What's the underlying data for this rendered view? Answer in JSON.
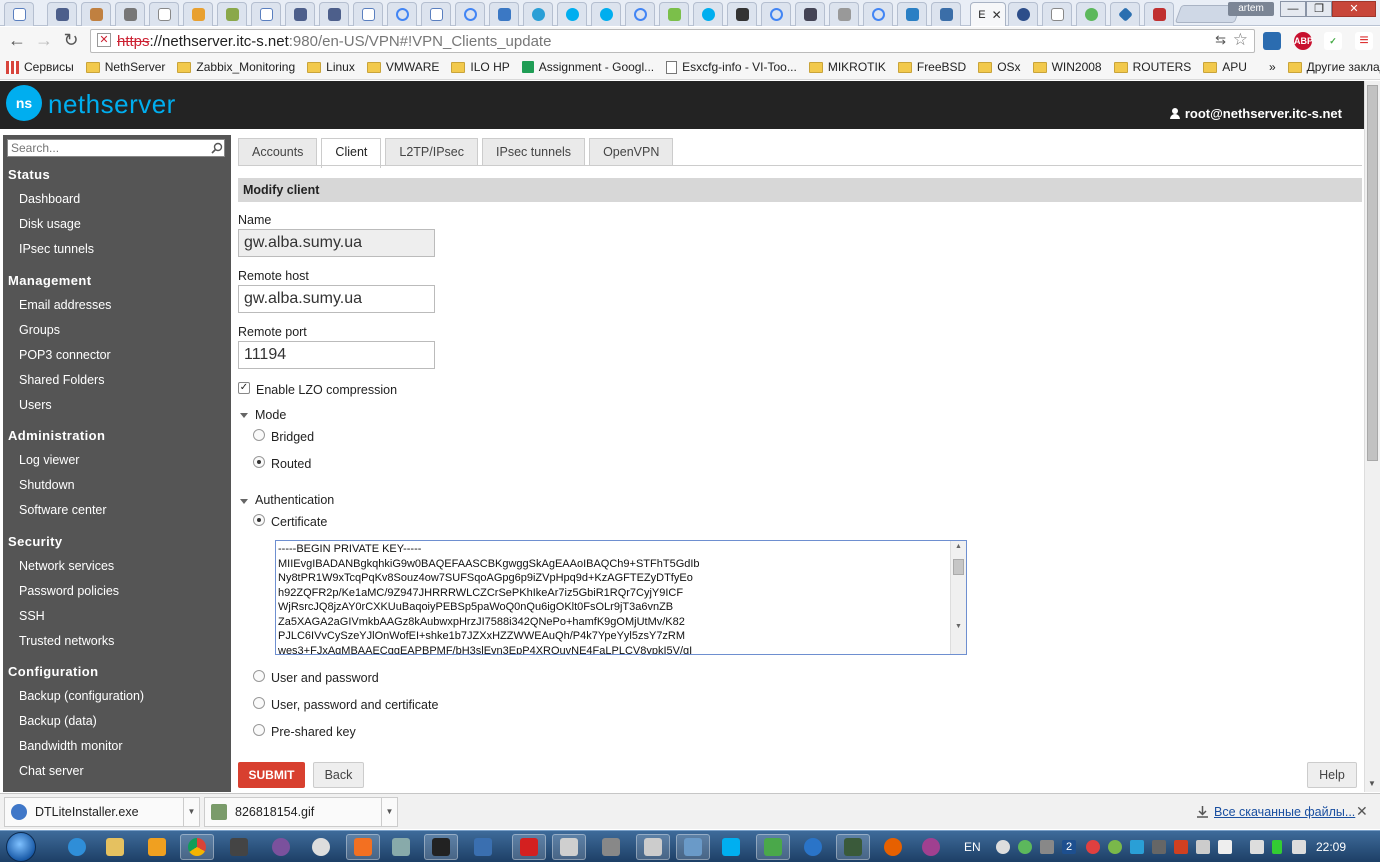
{
  "browser": {
    "active_tab_title": "E",
    "profile_name": "artem",
    "window_controls": {
      "minimize": "—",
      "maximize": "❐",
      "close": "✕"
    },
    "url_protocol": "https",
    "url_host": "://nethserver.itc-s.net",
    "url_rest": ":980/en-US/VPN#!VPN_Clients_update",
    "extensions": [
      "ABP"
    ],
    "bookmarks": [
      {
        "label": "Сервисы",
        "type": "apps"
      },
      {
        "label": "NethServer",
        "type": "folder"
      },
      {
        "label": "Zabbix_Monitoring",
        "type": "folder"
      },
      {
        "label": "Linux",
        "type": "folder"
      },
      {
        "label": "VMWARE",
        "type": "folder"
      },
      {
        "label": "ILO HP",
        "type": "folder"
      },
      {
        "label": "Assignment - Googl...",
        "type": "sheet"
      },
      {
        "label": "Esxcfg-info - VI-Too...",
        "type": "doc"
      },
      {
        "label": "MIKROTIK",
        "type": "folder"
      },
      {
        "label": "FreeBSD",
        "type": "folder"
      },
      {
        "label": "OSx",
        "type": "folder"
      },
      {
        "label": "WIN2008",
        "type": "folder"
      },
      {
        "label": "ROUTERS",
        "type": "folder"
      },
      {
        "label": "APU",
        "type": "folder"
      }
    ],
    "bookmarks_overflow": "»",
    "other_bookmarks": "Другие закладки"
  },
  "app": {
    "logo_mark": "ns",
    "logo_text": "nethserver",
    "user": "root@nethserver.itc-s.net"
  },
  "sidebar": {
    "search_placeholder": "Search...",
    "sections": [
      {
        "title": "Status",
        "items": [
          "Dashboard",
          "Disk usage",
          "IPsec tunnels"
        ]
      },
      {
        "title": "Management",
        "items": [
          "Email addresses",
          "Groups",
          "POP3 connector",
          "Shared Folders",
          "Users"
        ]
      },
      {
        "title": "Administration",
        "items": [
          "Log viewer",
          "Shutdown",
          "Software center"
        ]
      },
      {
        "title": "Security",
        "items": [
          "Network services",
          "Password policies",
          "SSH",
          "Trusted networks"
        ]
      },
      {
        "title": "Configuration",
        "items": [
          "Backup (configuration)",
          "Backup (data)",
          "Bandwidth monitor",
          "Chat server"
        ]
      }
    ]
  },
  "tabs": [
    "Accounts",
    "Client",
    "L2TP/IPsec",
    "IPsec tunnels",
    "OpenVPN"
  ],
  "active_tab": "Client",
  "form": {
    "title": "Modify client",
    "name_label": "Name",
    "name_value": "gw.alba.sumy.ua",
    "remote_host_label": "Remote host",
    "remote_host_value": "gw.alba.sumy.ua",
    "remote_port_label": "Remote port",
    "remote_port_value": "11194",
    "lzo_label": "Enable LZO compression",
    "lzo_checked": true,
    "mode_label": "Mode",
    "mode_bridged": "Bridged",
    "mode_routed": "Routed",
    "mode_selected": "Routed",
    "auth_label": "Authentication",
    "auth_certificate": "Certificate",
    "auth_user_password": "User and password",
    "auth_user_password_cert": "User, password and certificate",
    "auth_psk": "Pre-shared key",
    "auth_selected": "Certificate",
    "certificate_text": "-----BEGIN PRIVATE KEY-----\nMIIEvgIBADANBgkqhkiG9w0BAQEFAASCBKgwggSkAgEAAoIBAQCh9+STFhT5GdIb\nNy8tPR1W9xTcqPqKv8Souz4ow7SUFSqoAGpg6p9iZVpHpq9d+KzAGFTEZyDTfyEo\nh92ZQFR2p/Ke1aMC/9Z947JHRRRWLCZCrSePKhIkeAr7iz5GbiR1RQr7CyjY9ICF\nWjRsrcJQ8jzAY0rCXKUuBaqoiyPEBSp5paWoQ0nQu6igOKlt0FsOLr9jT3a6vnZB\nZa5XAGA2aGIVmkbAAGz8kAubwxpHrzJI7588i342QNePo+hamfK9gOMjUtMv/K82\nPJLC6IVvCySzeYJlOnWofEI+shke1b7JZXxHZZWWEAuQh/P4k7YpeYyl5zsY7zRM\nwes3+FJxAgMBAAECggEAPBPMF/bH3slEyn3EpP4XROuvNE4FaLPLCV8ypkI5V/gI\n81r0GGiQn9uSQ5?7tPKz8n3Ar4tbnzyTmKCkhK0YOj2Xe2jL17Acx1Dn0oV00"
  },
  "buttons": {
    "submit": "SUBMIT",
    "back": "Back",
    "help": "Help"
  },
  "downloads": {
    "items": [
      "DTLiteInstaller.exe",
      "826818154.gif"
    ],
    "show_all": "Все скачанные файлы...",
    "close": "✕"
  },
  "taskbar": {
    "lang": "EN",
    "clock": "22:09",
    "badge": "2"
  }
}
